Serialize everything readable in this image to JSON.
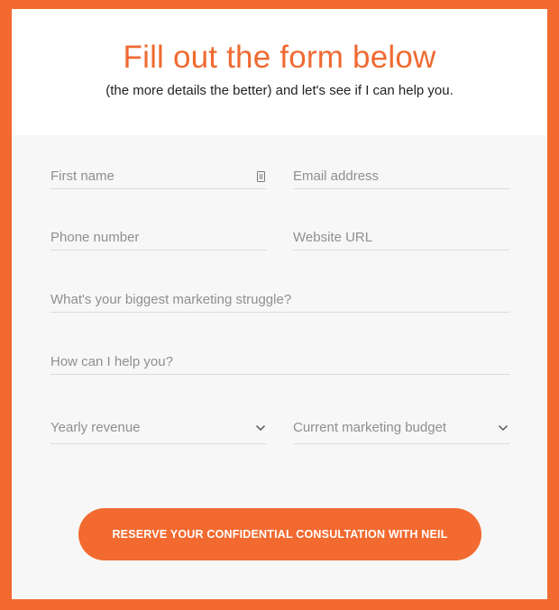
{
  "header": {
    "title": "Fill out the form below",
    "subtitle": "(the more details the better) and let's see if I can help you."
  },
  "form": {
    "first_name": {
      "placeholder": "First name",
      "value": ""
    },
    "email": {
      "placeholder": "Email address",
      "value": ""
    },
    "phone": {
      "placeholder": "Phone number",
      "value": ""
    },
    "website": {
      "placeholder": "Website URL",
      "value": ""
    },
    "struggle": {
      "placeholder": "What's your biggest marketing struggle?",
      "value": ""
    },
    "help": {
      "placeholder": "How can I help you?",
      "value": ""
    },
    "revenue": {
      "label": "Yearly revenue"
    },
    "budget": {
      "label": "Current marketing budget"
    },
    "submit_label": "RESERVE YOUR CONFIDENTIAL CONSULTATION WITH NEIL"
  },
  "colors": {
    "accent": "#f26a30",
    "panel_bg": "#f7f7f7",
    "placeholder": "#8f8f8f"
  },
  "icons": [
    "contact-card-icon",
    "chevron-down-icon"
  ]
}
